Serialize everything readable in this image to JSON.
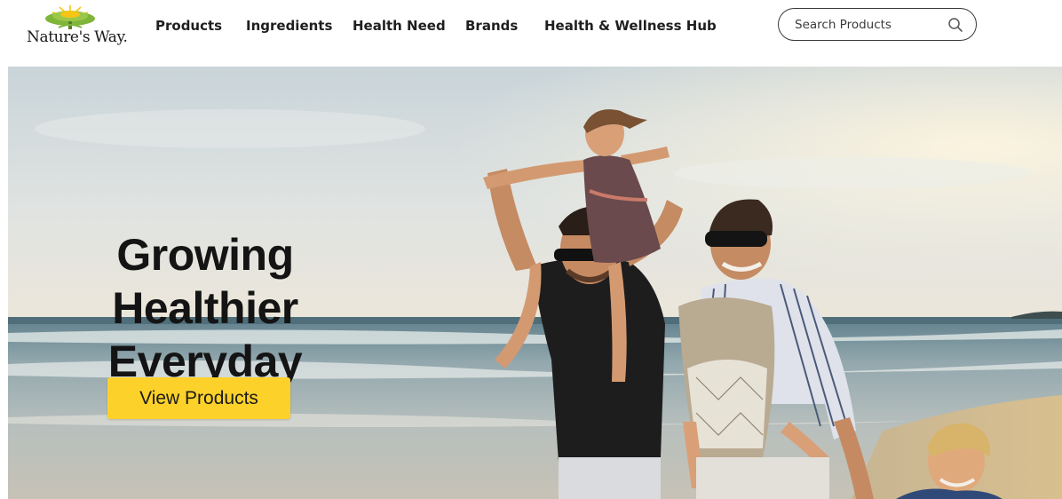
{
  "brand": {
    "name": "Nature's Way.",
    "logo_icon": "tree-logo-icon"
  },
  "nav": {
    "items": [
      {
        "label": "Products"
      },
      {
        "label": "Ingredients"
      },
      {
        "label": "Health Need"
      },
      {
        "label": "Brands"
      },
      {
        "label": "Health & Wellness Hub"
      }
    ]
  },
  "search": {
    "placeholder": "Search Products",
    "value": "",
    "icon": "search-icon"
  },
  "hero": {
    "title_line1": "Growing Healthier",
    "title_line2": "Everyday",
    "cta_label": "View Products",
    "image": "family-on-beach-photo"
  },
  "colors": {
    "accent": "#fcd12a",
    "text": "#1f1f1f",
    "logo_green": "#7fb539",
    "logo_yellow": "#f6c515"
  }
}
